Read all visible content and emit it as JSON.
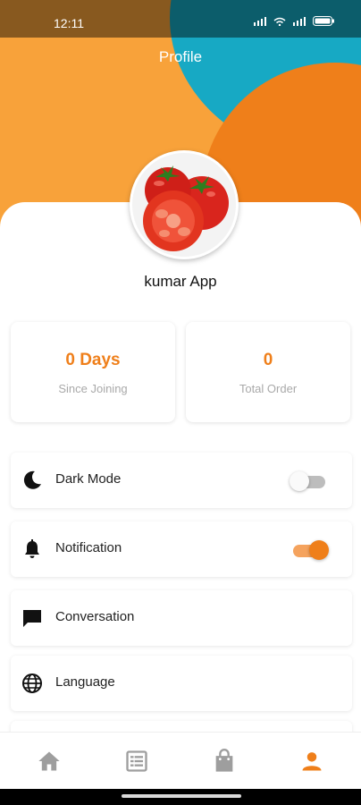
{
  "status_bar": {
    "time": "12:11",
    "icons": "signal-wifi-battery"
  },
  "header": {
    "title": "Profile"
  },
  "profile": {
    "name": "kumar App",
    "avatar": "tomato-image"
  },
  "stats": [
    {
      "value": "0 Days",
      "label": "Since Joining"
    },
    {
      "value": "0",
      "label": "Total Order"
    }
  ],
  "menu": [
    {
      "label": "Dark Mode",
      "icon": "moon-icon",
      "toggle": false
    },
    {
      "label": "Notification",
      "icon": "bell-icon",
      "toggle": true
    },
    {
      "label": "Conversation",
      "icon": "chat-icon"
    },
    {
      "label": "Language",
      "icon": "globe-icon"
    }
  ],
  "bottom_nav": [
    {
      "icon": "home-icon",
      "active": false
    },
    {
      "icon": "list-icon",
      "active": false
    },
    {
      "icon": "bag-icon",
      "active": false
    },
    {
      "icon": "person-icon",
      "active": true
    }
  ],
  "colors": {
    "accent": "#ef7f1a",
    "yellow": "#f8a23a",
    "teal": "#17a9c4",
    "inactive": "#9e9e9e"
  }
}
